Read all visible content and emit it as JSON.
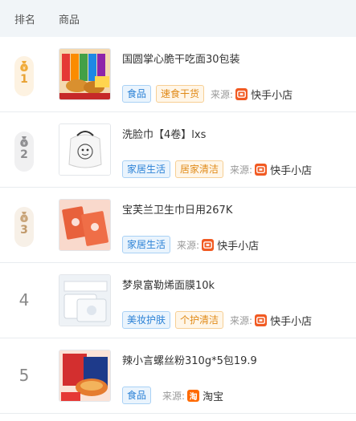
{
  "header": {
    "rank": "排名",
    "product": "商品"
  },
  "source_label": "来源:",
  "rows": [
    {
      "rank": "1",
      "title": "国圆掌心脆干吃面30包装",
      "tags": [
        {
          "text": "食品",
          "color": "blue"
        },
        {
          "text": "速食干货",
          "color": "orange"
        }
      ],
      "source": "快手小店",
      "source_icon": "kuaishou-icon"
    },
    {
      "rank": "2",
      "title": "洗脸巾【4卷】lxs",
      "tags": [
        {
          "text": "家居生活",
          "color": "blue"
        },
        {
          "text": "居家清洁",
          "color": "orange"
        }
      ],
      "source": "快手小店",
      "source_icon": "kuaishou-icon"
    },
    {
      "rank": "3",
      "title": "宝芙兰卫生巾日用267K",
      "tags": [
        {
          "text": "家居生活",
          "color": "blue"
        }
      ],
      "source": "快手小店",
      "source_icon": "kuaishou-icon"
    },
    {
      "rank": "4",
      "title": "梦泉富勒烯面膜10k",
      "tags": [
        {
          "text": "美妆护肤",
          "color": "blue"
        },
        {
          "text": "个护清洁",
          "color": "orange"
        }
      ],
      "source": "快手小店",
      "source_icon": "kuaishou-icon"
    },
    {
      "rank": "5",
      "title": "辣小言螺丝粉310g*5包19.9",
      "tags": [
        {
          "text": "食品",
          "color": "blue"
        }
      ],
      "source": "淘宝",
      "source_icon": "taobao-icon"
    }
  ],
  "taobao_glyph": "淘",
  "colors": {
    "blue_tag": "#2c82d6",
    "orange_tag": "#e08a18",
    "kuaishou": "#f15a22",
    "taobao": "#ff6a00"
  }
}
